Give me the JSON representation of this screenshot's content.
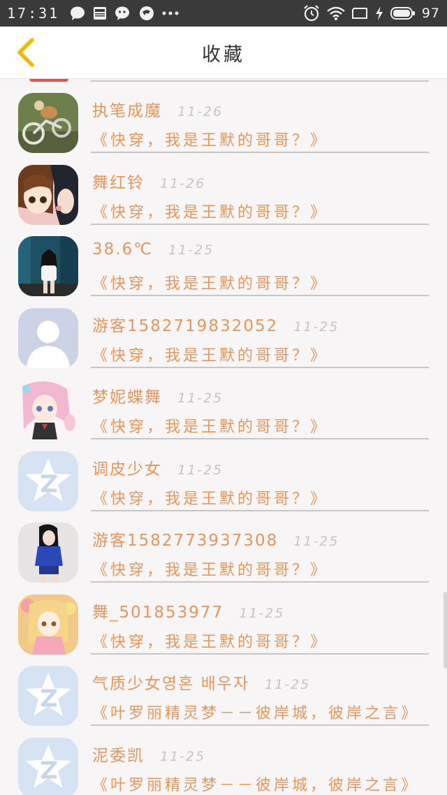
{
  "status_bar": {
    "time": "17:31",
    "battery": "97",
    "left_icons": [
      "chat-bubble-icon",
      "news-icon",
      "wechat-icon",
      "browser-icon",
      "more-dots-icon"
    ],
    "right_icons": [
      "alarm-clock-icon",
      "wifi-icon",
      "screen-icon",
      "charging-icon",
      "battery-icon"
    ]
  },
  "header": {
    "title": "收藏",
    "back_icon": "chevron-left-icon",
    "accent_color": "#f3c41a"
  },
  "colors": {
    "text_accent": "#e4975c",
    "date": "#c7c4c4",
    "divider": "#c9c5c5"
  },
  "items": [
    {
      "username": "执笔成魔",
      "date": "11-26",
      "title": "《快穿，我是王默的哥哥？》",
      "avatar": "motorbike-photo"
    },
    {
      "username": "舞红铃",
      "date": "11-26",
      "title": "《快穿，我是王默的哥哥？》",
      "avatar": "anime-duo"
    },
    {
      "username": "38.6℃",
      "date": "11-25",
      "title": "《快穿，我是王默的哥哥？》",
      "avatar": "girl-blue-background"
    },
    {
      "username": "游客1582719832052",
      "date": "11-25",
      "title": "《快穿，我是王默的哥哥？》",
      "avatar": "default-person"
    },
    {
      "username": "梦妮蝶舞",
      "date": "11-25",
      "title": "《快穿，我是王默的哥哥？》",
      "avatar": "anime-pink-hair"
    },
    {
      "username": "调皮少女",
      "date": "11-25",
      "title": "《快穿，我是王默的哥哥？》",
      "avatar": "qzone-star"
    },
    {
      "username": "游客1582773937308",
      "date": "11-25",
      "title": "《快穿，我是王默的哥哥？》",
      "avatar": "girl-blue-outfit"
    },
    {
      "username": "舞_501853977",
      "date": "11-25",
      "title": "《快穿，我是王默的哥哥？》",
      "avatar": "anime-golden"
    },
    {
      "username": "气质少女영혼 배우자",
      "date": "11-25",
      "title": "《叶罗丽精灵梦－－彼岸城，彼岸之言》",
      "avatar": "qzone-star"
    },
    {
      "username": "泥委凯",
      "date": "11-25",
      "title": "《叶罗丽精灵梦－－彼岸城，彼岸之言》",
      "avatar": "qzone-star"
    }
  ]
}
